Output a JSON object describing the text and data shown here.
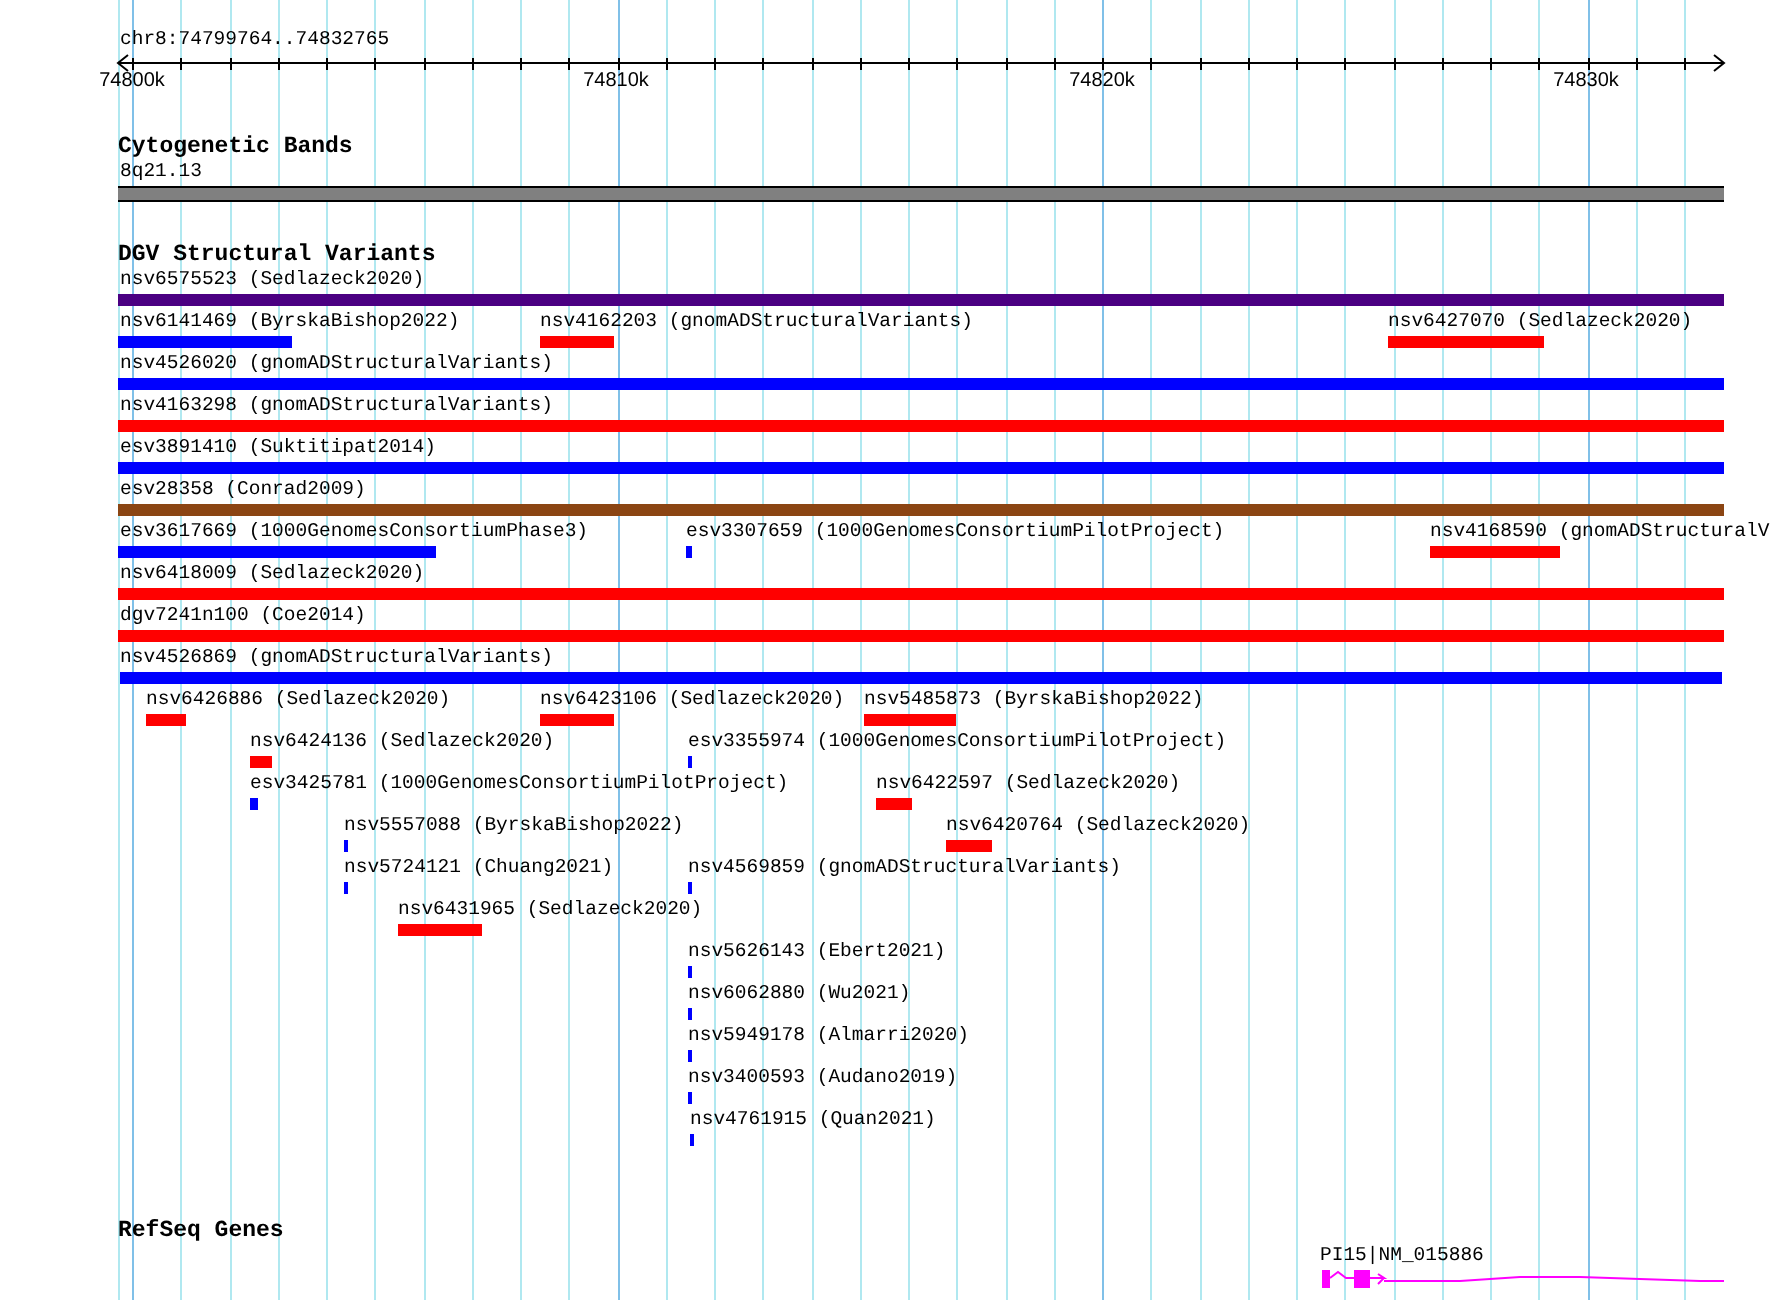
{
  "ruler": {
    "title": "chr8:74799764..74832765",
    "ticks": [
      "74800k",
      "74810k",
      "74820k",
      "74830k"
    ]
  },
  "tracks": [
    {
      "title": "Cytogenetic Bands",
      "kind": "bands",
      "features": [
        {
          "label": "8q21.13",
          "color": "#808080"
        }
      ]
    },
    {
      "title": "DGV Structural Variants",
      "kind": "variants",
      "features": [
        {
          "label": "nsv6575523 (Sedlazeck2020)",
          "color": "#4b0082"
        },
        {
          "label": "nsv6141469 (ByrskaBishop2022)",
          "color": "#0000ff"
        },
        {
          "label": "nsv4162203 (gnomADStructuralVariants)",
          "color": "#ff0000"
        },
        {
          "label": "nsv6427070 (Sedlazeck2020)",
          "color": "#ff0000"
        },
        {
          "label": "nsv4526020 (gnomADStructuralVariants)",
          "color": "#0000ff"
        },
        {
          "label": "nsv4163298 (gnomADStructuralVariants)",
          "color": "#ff0000"
        },
        {
          "label": "esv3891410 (Suktitipat2014)",
          "color": "#0000ff"
        },
        {
          "label": "esv28358 (Conrad2009)",
          "color": "#8b4513"
        },
        {
          "label": "esv3617669 (1000GenomesConsortiumPhase3)",
          "color": "#0000ff"
        },
        {
          "label": "esv3307659 (1000GenomesConsortiumPilotProject)",
          "color": "#0000ff"
        },
        {
          "label": "nsv4168590 (gnomADStructuralV",
          "color": "#ff0000"
        },
        {
          "label": "nsv6418009 (Sedlazeck2020)",
          "color": "#ff0000"
        },
        {
          "label": "dgv7241n100 (Coe2014)",
          "color": "#ff0000"
        },
        {
          "label": "nsv4526869 (gnomADStructuralVariants)",
          "color": "#0000ff"
        },
        {
          "label": "nsv6426886 (Sedlazeck2020)",
          "color": "#ff0000"
        },
        {
          "label": "nsv6423106 (Sedlazeck2020)",
          "color": "#ff0000"
        },
        {
          "label": "nsv5485873 (ByrskaBishop2022)",
          "color": "#ff0000"
        },
        {
          "label": "nsv6424136 (Sedlazeck2020)",
          "color": "#ff0000"
        },
        {
          "label": "esv3355974 (1000GenomesConsortiumPilotProject)",
          "color": "#0000ff"
        },
        {
          "label": "esv3425781 (1000GenomesConsortiumPilotProject)",
          "color": "#0000ff"
        },
        {
          "label": "nsv6422597 (Sedlazeck2020)",
          "color": "#ff0000"
        },
        {
          "label": "nsv5557088 (ByrskaBishop2022)",
          "color": "#0000ff"
        },
        {
          "label": "nsv6420764 (Sedlazeck2020)",
          "color": "#ff0000"
        },
        {
          "label": "nsv5724121 (Chuang2021)",
          "color": "#0000ff"
        },
        {
          "label": "nsv4569859 (gnomADStructuralVariants)",
          "color": "#0000ff"
        },
        {
          "label": "nsv6431965 (Sedlazeck2020)",
          "color": "#ff0000"
        },
        {
          "label": "nsv5626143 (Ebert2021)",
          "color": "#0000ff"
        },
        {
          "label": "nsv6062880 (Wu2021)",
          "color": "#0000ff"
        },
        {
          "label": "nsv5949178 (Almarri2020)",
          "color": "#0000ff"
        },
        {
          "label": "nsv3400593 (Audano2019)",
          "color": "#0000ff"
        },
        {
          "label": "nsv4761915 (Quan2021)",
          "color": "#0000ff"
        }
      ]
    },
    {
      "title": "RefSeq Genes",
      "kind": "genes",
      "features": [
        {
          "label": "PI15|NM_015886",
          "color": "#ff00ff"
        }
      ]
    }
  ]
}
